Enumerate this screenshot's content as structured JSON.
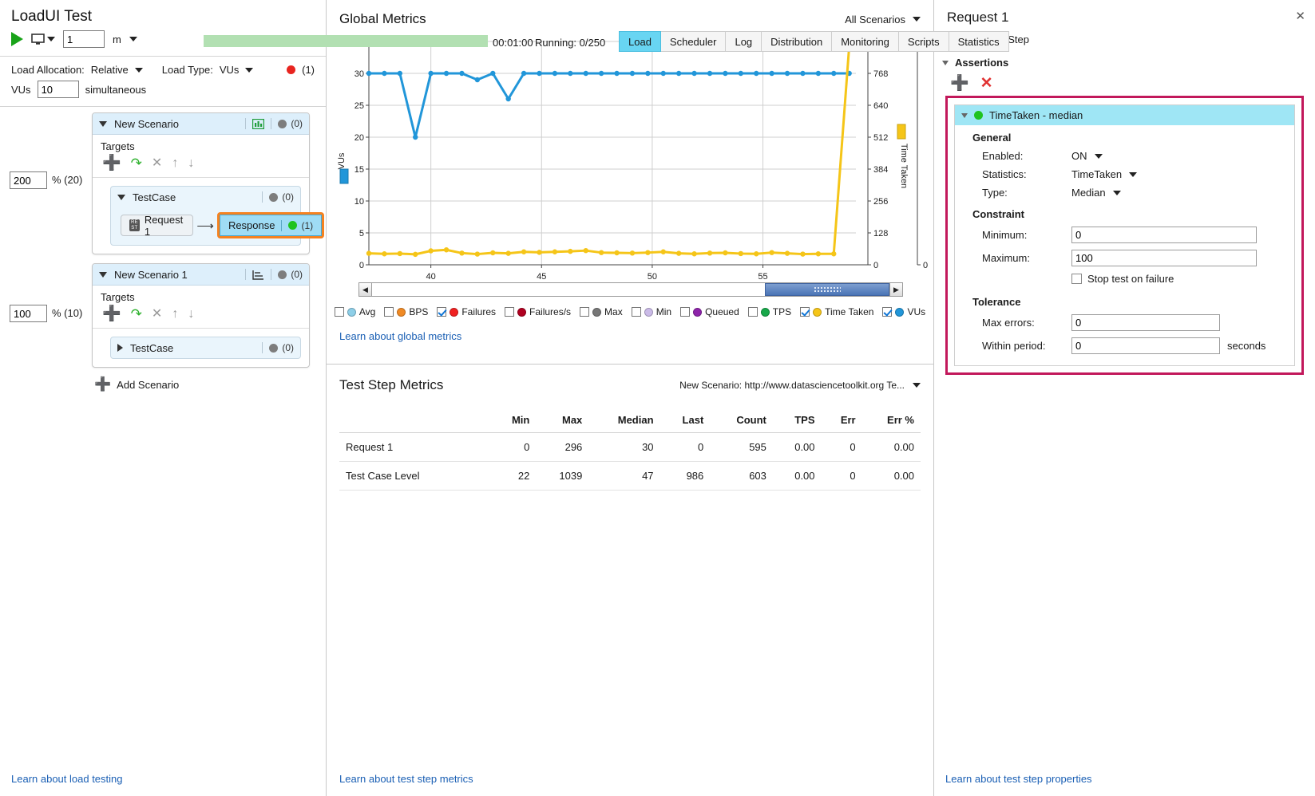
{
  "left": {
    "app_title": "LoadUI Test",
    "toolbar": {
      "play_name": "run-test",
      "duration_value": "1",
      "duration_unit": "m",
      "elapsed": "00:01:00"
    },
    "allocation": {
      "load_allocation_label": "Load Allocation:",
      "load_allocation_value": "Relative",
      "load_type_label": "Load Type:",
      "load_type_value": "VUs",
      "status_count": "(1)",
      "vus_label": "VUs",
      "vus_value": "10",
      "vus_suffix": "simultaneous"
    },
    "scenarios": [
      {
        "name": "New Scenario",
        "count": "(0)",
        "pct": "200",
        "pct_label": "% (20)",
        "targets_label": "Targets",
        "testcase": {
          "name": "TestCase",
          "count": "(0)",
          "expanded": true,
          "step_label": "Request 1",
          "step_icon_text": "RE ST",
          "response_label": "Response",
          "response_count": "(1)"
        }
      },
      {
        "name": "New Scenario 1",
        "count": "(0)",
        "pct": "100",
        "pct_label": "% (10)",
        "targets_label": "Targets",
        "testcase": {
          "name": "TestCase",
          "count": "(0)",
          "expanded": false
        }
      }
    ],
    "add_scenario_label": "Add Scenario",
    "footer_link": "Learn about load testing"
  },
  "tabs": [
    {
      "label": "Load",
      "active": true
    },
    {
      "label": "Scheduler",
      "active": false
    },
    {
      "label": "Log",
      "active": false
    },
    {
      "label": "Distribution",
      "active": false
    },
    {
      "label": "Monitoring",
      "active": false
    },
    {
      "label": "Scripts",
      "active": false
    },
    {
      "label": "Statistics",
      "active": false
    }
  ],
  "status": {
    "elapsed": "00:01:00",
    "running": "Running: 0/250"
  },
  "global_metrics": {
    "title": "Global Metrics",
    "scenario_selector": "All Scenarios",
    "learn_link": "Learn about global metrics"
  },
  "chart_data": {
    "type": "line",
    "title": "Global Metrics",
    "xlabel": "",
    "ylabel": "VUs",
    "grid": true,
    "legend_position": "bottom",
    "xlim": [
      37.2,
      59.2
    ],
    "xticks": [
      40,
      45,
      50,
      55
    ],
    "axes": [
      {
        "name": "VUs",
        "side": "left",
        "color": "#2196d9",
        "ylim": [
          0,
          35
        ],
        "yticks": [
          0,
          5,
          10,
          15,
          20,
          25,
          30,
          35
        ]
      },
      {
        "name": "Time Taken",
        "side": "right",
        "color": "#f5c518",
        "ylim": [
          0,
          896
        ],
        "yticks": [
          0,
          128,
          256,
          384,
          512,
          640,
          768,
          896
        ]
      },
      {
        "name": "Failures",
        "side": "right-outer",
        "color": "#e02020",
        "ylim": [
          0,
          0
        ],
        "yticks": [
          0,
          0
        ]
      }
    ],
    "x": [
      37.2,
      37.9,
      38.6,
      39.3,
      40.0,
      40.7,
      41.4,
      42.1,
      42.8,
      43.5,
      44.2,
      44.9,
      45.6,
      46.3,
      47.0,
      47.7,
      48.4,
      49.1,
      49.8,
      50.5,
      51.2,
      51.9,
      52.6,
      53.3,
      54.0,
      54.7,
      55.4,
      56.1,
      56.8,
      57.5,
      58.2,
      58.9
    ],
    "series": [
      {
        "name": "VUs",
        "axis": "VUs",
        "color": "#2196d9",
        "values": [
          30,
          30,
          30,
          20,
          30,
          30,
          30,
          29,
          30,
          26,
          30,
          30,
          30,
          30,
          30,
          30,
          30,
          30,
          30,
          30,
          30,
          30,
          30,
          30,
          30,
          30,
          30,
          30,
          30,
          30,
          30,
          30
        ]
      },
      {
        "name": "Time Taken",
        "axis": "Time Taken",
        "color": "#f5c518",
        "values": [
          46,
          44,
          45,
          42,
          56,
          60,
          47,
          43,
          48,
          46,
          52,
          50,
          52,
          54,
          57,
          49,
          48,
          47,
          49,
          52,
          46,
          44,
          47,
          48,
          45,
          44,
          49,
          46,
          43,
          44,
          44,
          880
        ]
      }
    ],
    "legend": [
      {
        "label": "Avg",
        "color": "#8ecfe8",
        "checked": false
      },
      {
        "label": "BPS",
        "color": "#f08a24",
        "checked": false
      },
      {
        "label": "Failures",
        "color": "#f02020",
        "checked": true
      },
      {
        "label": "Failures/s",
        "color": "#b00020",
        "checked": false
      },
      {
        "label": "Max",
        "color": "#777777",
        "checked": false
      },
      {
        "label": "Min",
        "color": "#cbbbe8",
        "checked": false
      },
      {
        "label": "Queued",
        "color": "#8e24aa",
        "checked": false
      },
      {
        "label": "TPS",
        "color": "#17a84a",
        "checked": false
      },
      {
        "label": "Time Taken",
        "color": "#f5c518",
        "checked": true
      },
      {
        "label": "VUs",
        "color": "#2196d9",
        "checked": true
      }
    ]
  },
  "test_step_metrics": {
    "title": "Test Step Metrics",
    "scenario": "New Scenario: http://www.datasciencetoolkit.org Te...",
    "columns": [
      "",
      "Min",
      "Max",
      "Median",
      "Last",
      "Count",
      "TPS",
      "Err",
      "Err %"
    ],
    "rows": [
      {
        "label": "Request 1",
        "values": [
          "0",
          "296",
          "30",
          "0",
          "595",
          "0.00",
          "0",
          "0.00"
        ]
      },
      {
        "label": "Test Case Level",
        "values": [
          "22",
          "1039",
          "47",
          "986",
          "603",
          "0.00",
          "0",
          "0.00"
        ]
      }
    ],
    "learn_link": "Learn about test step metrics"
  },
  "right": {
    "title": "Request 1",
    "edit_test_step": "Edit Test Step",
    "assertions_label": "Assertions",
    "assertion": {
      "name": "TimeTaken - median",
      "general_label": "General",
      "enabled_label": "Enabled:",
      "enabled_value": "ON",
      "statistics_label": "Statistics:",
      "statistics_value": "TimeTaken",
      "type_label": "Type:",
      "type_value": "Median",
      "constraint_label": "Constraint",
      "minimum_label": "Minimum:",
      "minimum_value": "0",
      "maximum_label": "Maximum:",
      "maximum_value": "100",
      "stop_on_failure_label": "Stop test on failure",
      "stop_on_failure_checked": false,
      "tolerance_label": "Tolerance",
      "max_errors_label": "Max errors:",
      "max_errors_value": "0",
      "within_period_label": "Within period:",
      "within_period_value": "0",
      "within_period_unit": "seconds"
    },
    "footer_link": "Learn about test step properties"
  },
  "colors": {
    "accent_blue": "#2196d9",
    "accent_yellow": "#f5c518",
    "accent_red": "#e02020",
    "highlight_orange": "#f58220",
    "highlight_pink": "#c2185b",
    "tab_active": "#68d5f2"
  }
}
